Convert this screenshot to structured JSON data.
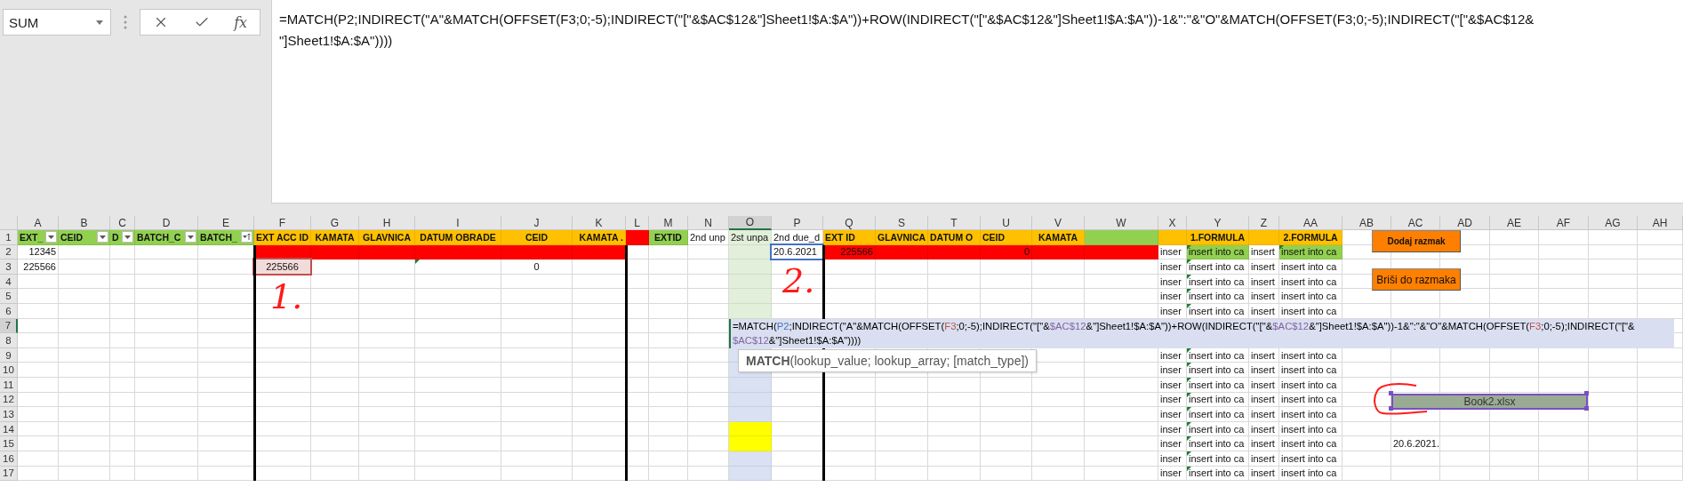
{
  "name_box": {
    "value": "SUM"
  },
  "formula_bar": {
    "function_label": "fx",
    "lines": [
      "=MATCH(P2;INDIRECT(\"A\"&MATCH(OFFSET(F3;0;-5);INDIRECT(\"[\"&$AC$12&\"]Sheet1!$A:$A\"))+ROW(INDIRECT(\"[\"&$AC$12&\"]Sheet1!$A:$A\"))-1&\":\"&\"O\"&MATCH(OFFSET(F3;0;-5);INDIRECT(\"[\"&$AC$12&",
      "\"]Sheet1!$A:$A\"))))"
    ]
  },
  "columns": [
    {
      "letter": "A",
      "selected": false
    },
    {
      "letter": "B",
      "selected": false
    },
    {
      "letter": "C",
      "selected": false
    },
    {
      "letter": "D",
      "selected": false
    },
    {
      "letter": "E",
      "selected": false
    },
    {
      "letter": "F",
      "selected": false
    },
    {
      "letter": "G",
      "selected": false
    },
    {
      "letter": "H",
      "selected": false
    },
    {
      "letter": "I",
      "selected": false
    },
    {
      "letter": "J",
      "selected": false
    },
    {
      "letter": "K",
      "selected": false
    },
    {
      "letter": "L",
      "selected": false
    },
    {
      "letter": "M",
      "selected": false
    },
    {
      "letter": "N",
      "selected": false
    },
    {
      "letter": "O",
      "selected": true
    },
    {
      "letter": "P",
      "selected": false
    },
    {
      "letter": "Q",
      "selected": false
    },
    {
      "letter": "S",
      "selected": false
    },
    {
      "letter": "T",
      "selected": false
    },
    {
      "letter": "U",
      "selected": false
    },
    {
      "letter": "V",
      "selected": false
    },
    {
      "letter": "W",
      "selected": false
    },
    {
      "letter": "X",
      "selected": false
    },
    {
      "letter": "Y",
      "selected": false
    },
    {
      "letter": "Z",
      "selected": false
    },
    {
      "letter": "AA",
      "selected": false
    },
    {
      "letter": "AB",
      "selected": false
    },
    {
      "letter": "AC",
      "selected": false
    },
    {
      "letter": "AD",
      "selected": false
    },
    {
      "letter": "AE",
      "selected": false
    },
    {
      "letter": "AF",
      "selected": false
    },
    {
      "letter": "AG",
      "selected": false
    },
    {
      "letter": "AH",
      "selected": false
    }
  ],
  "rows": [
    {
      "number": "1",
      "selected": false,
      "cells": [
        {
          "text": "EXT_",
          "color": "#92d050",
          "bold": true,
          "filter": true
        },
        {
          "text": "CEID",
          "color": "#92d050",
          "bold": true,
          "filter": true
        },
        {
          "text": "D",
          "color": "#92d050",
          "bold": true,
          "filter": true
        },
        {
          "text": "BATCH_C",
          "color": "#92d050",
          "bold": true,
          "filter": true
        },
        {
          "text": "BATCH_",
          "color": "#92d050",
          "bold": true,
          "filter": true,
          "sorted": true
        },
        {
          "text": "EXT ACC ID",
          "color": "#ffc000",
          "bold": true,
          "centered": true
        },
        {
          "text": "KAMATA",
          "color": "#ffc000",
          "bold": true,
          "centered": true
        },
        {
          "text": "GLAVNICA",
          "color": "#ffc000",
          "bold": true,
          "centered": true
        },
        {
          "text": "DATUM OBRADE",
          "color": "#ffc000",
          "bold": true,
          "centered": true
        },
        {
          "text": "CEID",
          "color": "#ffc000",
          "bold": true,
          "centered": true
        },
        {
          "text": "KAMATA .",
          "color": "#ffc000",
          "bold": true,
          "right_aligned": true
        },
        {
          "color": "#ff0000"
        },
        {
          "text": "EXTID",
          "color": "#92d050",
          "bold": true,
          "centered": true
        },
        {
          "text": "2nd unp"
        },
        {
          "text": "2st unpa",
          "color": "#e2efda"
        },
        {
          "text": "2nd due_d"
        },
        {
          "text": "EXT ID",
          "color": "#ffc000",
          "bold": true
        },
        {
          "text": "GLAVNICA",
          "color": "#ffc000",
          "bold": true
        },
        {
          "text": "DATUM O",
          "color": "#ffc000",
          "bold": true
        },
        {
          "text": "CEID",
          "color": "#ffc000",
          "bold": true
        },
        {
          "text": "KAMATA",
          "color": "#ffc000",
          "bold": true,
          "centered": true
        },
        {
          "color": "#92d050"
        },
        {
          "color": "#ffc000"
        },
        {
          "text": "1.FORMULA",
          "color": "#ffc000",
          "bold": true,
          "centered": true
        },
        {
          "color": "#ffc000"
        },
        {
          "text": "2.FORMULA",
          "color": "#ffc000",
          "bold": true,
          "centered": true
        }
      ]
    },
    {
      "number": "2",
      "selected": false,
      "cells": [
        {
          "text": "12345",
          "right_aligned": true
        },
        {},
        {},
        {},
        {},
        {
          "color": "#ff0000"
        },
        {
          "color": "#ff0000"
        },
        {
          "color": "#ff0000"
        },
        {
          "color": "#ff0000"
        },
        {
          "color": "#ff0000"
        },
        {
          "color": "#ff0000"
        },
        {},
        {},
        {},
        {
          "color": "#e2efda"
        },
        {
          "text": "20.6.2021",
          "outline": {
            "color": "#4472c4"
          }
        },
        {
          "text": "225566",
          "color": "#ff0000",
          "right_aligned": true
        },
        {
          "color": "#ff0000"
        },
        {
          "color": "#ff0000"
        },
        {
          "text": "0",
          "color": "#ff0000",
          "right_aligned": true
        },
        {
          "color": "#ff0000"
        },
        {
          "color": "#ff0000"
        },
        {
          "text": "inser"
        },
        {
          "text": "insert into ca",
          "color": "#92d050",
          "flagged": true
        },
        {
          "text": "insert"
        },
        {
          "text": "insert into ca",
          "color": "#92d050",
          "flagged": true
        }
      ]
    },
    {
      "number": "3",
      "selected": false,
      "cells": [
        {
          "text": "225566",
          "right_aligned": true
        },
        {},
        {},
        {},
        {},
        {
          "text": "225566",
          "color": "#f2dcdb",
          "outline": {
            "color": "#c0504d"
          },
          "centered": true
        },
        {},
        {},
        {
          "flagged": true
        },
        {
          "text": "0",
          "centered": true
        },
        {},
        {},
        {},
        {},
        {
          "color": "#e2efda"
        },
        {},
        {},
        {},
        {},
        {},
        {},
        {},
        {
          "text": "inser"
        },
        {
          "text": "insert into ca",
          "flagged": true
        },
        {
          "text": "insert"
        },
        {
          "text": "insert into ca"
        }
      ]
    },
    {
      "number": "4",
      "selected": false,
      "cells": [
        {},
        {},
        {},
        {},
        {},
        {},
        {},
        {},
        {},
        {},
        {},
        {},
        {},
        {},
        {
          "color": "#e2efda"
        },
        {},
        {},
        {},
        {},
        {},
        {},
        {},
        {
          "text": "inser"
        },
        {
          "text": "insert into ca",
          "flagged": true
        },
        {
          "text": "insert"
        },
        {
          "text": "insert into ca"
        }
      ]
    },
    {
      "number": "5",
      "selected": false,
      "cells": [
        {},
        {},
        {},
        {},
        {},
        {},
        {},
        {},
        {},
        {},
        {},
        {},
        {},
        {},
        {
          "color": "#e2efda"
        },
        {},
        {},
        {},
        {},
        {},
        {},
        {},
        {
          "text": "inser"
        },
        {
          "text": "insert into ca",
          "flagged": true
        },
        {
          "text": "insert"
        },
        {
          "text": "insert into ca"
        }
      ]
    },
    {
      "number": "6",
      "selected": false,
      "cells": [
        {},
        {},
        {},
        {},
        {},
        {},
        {},
        {},
        {},
        {},
        {},
        {},
        {},
        {},
        {
          "color": "#e2efda"
        },
        {},
        {},
        {},
        {},
        {},
        {},
        {},
        {
          "text": "inser"
        },
        {
          "text": "insert into ca",
          "flagged": true
        },
        {
          "text": "insert"
        },
        {
          "text": "insert into ca"
        }
      ]
    },
    {
      "number": "7",
      "selected": true,
      "cells": []
    },
    {
      "number": "8",
      "selected": false,
      "cells": []
    },
    {
      "number": "9",
      "selected": false,
      "cells": [
        {},
        {},
        {},
        {},
        {},
        {},
        {},
        {},
        {},
        {},
        {},
        {},
        {},
        {},
        {
          "color": "#d9e1f2"
        },
        {},
        {},
        {},
        {},
        {},
        {},
        {},
        {
          "text": "inser"
        },
        {
          "text": "insert into ca",
          "flagged": true
        },
        {
          "text": "insert"
        },
        {
          "text": "insert into ca"
        }
      ]
    },
    {
      "number": "10",
      "selected": false,
      "cells": [
        {},
        {},
        {},
        {},
        {},
        {},
        {},
        {},
        {},
        {},
        {},
        {},
        {},
        {},
        {
          "color": "#d9e1f2"
        },
        {},
        {},
        {},
        {},
        {},
        {},
        {},
        {
          "text": "inser"
        },
        {
          "text": "insert into ca",
          "flagged": true
        },
        {
          "text": "insert"
        },
        {
          "text": "insert into ca"
        }
      ]
    },
    {
      "number": "11",
      "selected": false,
      "cells": [
        {},
        {},
        {},
        {},
        {},
        {},
        {},
        {},
        {},
        {},
        {},
        {},
        {},
        {},
        {
          "color": "#d9e1f2"
        },
        {},
        {},
        {},
        {},
        {},
        {},
        {},
        {
          "text": "inser"
        },
        {
          "text": "insert into ca",
          "flagged": true
        },
        {
          "text": "insert"
        },
        {
          "text": "insert into ca"
        }
      ]
    },
    {
      "number": "12",
      "selected": false,
      "cells": [
        {},
        {},
        {},
        {},
        {},
        {},
        {},
        {},
        {},
        {},
        {},
        {},
        {},
        {},
        {
          "color": "#d9e1f2"
        },
        {},
        {},
        {},
        {},
        {},
        {},
        {},
        {
          "text": "inser"
        },
        {
          "text": "insert into ca",
          "flagged": true
        },
        {
          "text": "insert"
        },
        {
          "text": "insert into ca"
        }
      ]
    },
    {
      "number": "13",
      "selected": false,
      "cells": [
        {},
        {},
        {},
        {},
        {},
        {},
        {},
        {},
        {},
        {},
        {},
        {},
        {},
        {},
        {
          "color": "#d9e1f2"
        },
        {},
        {},
        {},
        {},
        {},
        {},
        {},
        {
          "text": "inser"
        },
        {
          "text": "insert into ca",
          "flagged": true
        },
        {
          "text": "insert"
        },
        {
          "text": "insert into ca"
        }
      ]
    },
    {
      "number": "14",
      "selected": false,
      "cells": [
        {},
        {},
        {},
        {},
        {},
        {},
        {},
        {},
        {},
        {},
        {},
        {},
        {},
        {},
        {
          "color": "#ffff00"
        },
        {},
        {},
        {},
        {},
        {},
        {},
        {},
        {
          "text": "inser"
        },
        {
          "text": "insert into ca",
          "flagged": true
        },
        {
          "text": "insert"
        },
        {
          "text": "insert into ca"
        }
      ]
    },
    {
      "number": "15",
      "selected": false,
      "cells": [
        {},
        {},
        {},
        {},
        {},
        {},
        {},
        {},
        {},
        {},
        {},
        {},
        {},
        {},
        {
          "color": "#ffff00"
        },
        {},
        {},
        {},
        {},
        {},
        {},
        {},
        {
          "text": "inser"
        },
        {
          "text": "insert into ca",
          "flagged": true
        },
        {
          "text": "insert"
        },
        {
          "text": "insert into ca"
        },
        {},
        {
          "text": "20.6.2021."
        }
      ]
    },
    {
      "number": "16",
      "selected": false,
      "cells": [
        {},
        {},
        {},
        {},
        {},
        {},
        {},
        {},
        {},
        {},
        {},
        {},
        {},
        {},
        {
          "color": "#d9e1f2"
        },
        {},
        {},
        {},
        {},
        {},
        {},
        {},
        {
          "text": "inser"
        },
        {
          "text": "insert into ca",
          "flagged": true
        },
        {
          "text": "insert"
        },
        {
          "text": "insert into ca"
        }
      ]
    },
    {
      "number": "17",
      "selected": false,
      "cells": [
        {},
        {},
        {},
        {},
        {},
        {},
        {},
        {},
        {},
        {},
        {},
        {},
        {},
        {},
        {
          "color": "#d9e1f2"
        },
        {},
        {},
        {},
        {},
        {},
        {},
        {},
        {
          "text": "inser"
        },
        {
          "text": "insert into ca",
          "flagged": true
        },
        {
          "text": "insert"
        },
        {
          "text": "insert into ca"
        }
      ]
    }
  ],
  "formula_editor": {
    "lines": [
      [
        {
          "text": "=MATCH(",
          "color": "#000000"
        },
        {
          "text": "P2",
          "color": "#4472c4"
        },
        {
          "text": ";INDIRECT(\"A\"&MATCH(OFFSET(",
          "color": "#000000"
        },
        {
          "text": "F3",
          "color": "#c0504d"
        },
        {
          "text": ";0;-5);INDIRECT(\"[\"&",
          "color": "#000000"
        },
        {
          "text": "$AC$12",
          "color": "#8064a2"
        },
        {
          "text": "&\"]Sheet1!$A:$A\"))+ROW(INDIRECT(\"[\"&",
          "color": "#000000"
        },
        {
          "text": "$AC$12",
          "color": "#8064a2"
        },
        {
          "text": "&\"]Sheet1!$A:$A\"))-1&\":\"&\"O\"&MATCH(OFFSET(",
          "color": "#000000"
        },
        {
          "text": "F3",
          "color": "#c0504d"
        },
        {
          "text": ";0;-5);INDIRECT(\"[\"&",
          "color": "#000000"
        }
      ],
      [
        {
          "text": "$AC$12",
          "color": "#8064a2"
        },
        {
          "text": "&\"]Sheet1!$A:$A\"))))",
          "color": "#000000"
        }
      ]
    ]
  },
  "tooltip": {
    "text": "**MATCH**(lookup_value; lookup_array; [match_type])"
  },
  "buttons": [
    {
      "label": "Dodaj razmak",
      "bold": true
    },
    {
      "label": "Briši do razmaka",
      "bold": false
    }
  ],
  "file_field": {
    "value": "Book2.xlsx",
    "selected": true
  },
  "annotations": [
    {
      "text": "1."
    },
    {
      "text": "2."
    }
  ]
}
